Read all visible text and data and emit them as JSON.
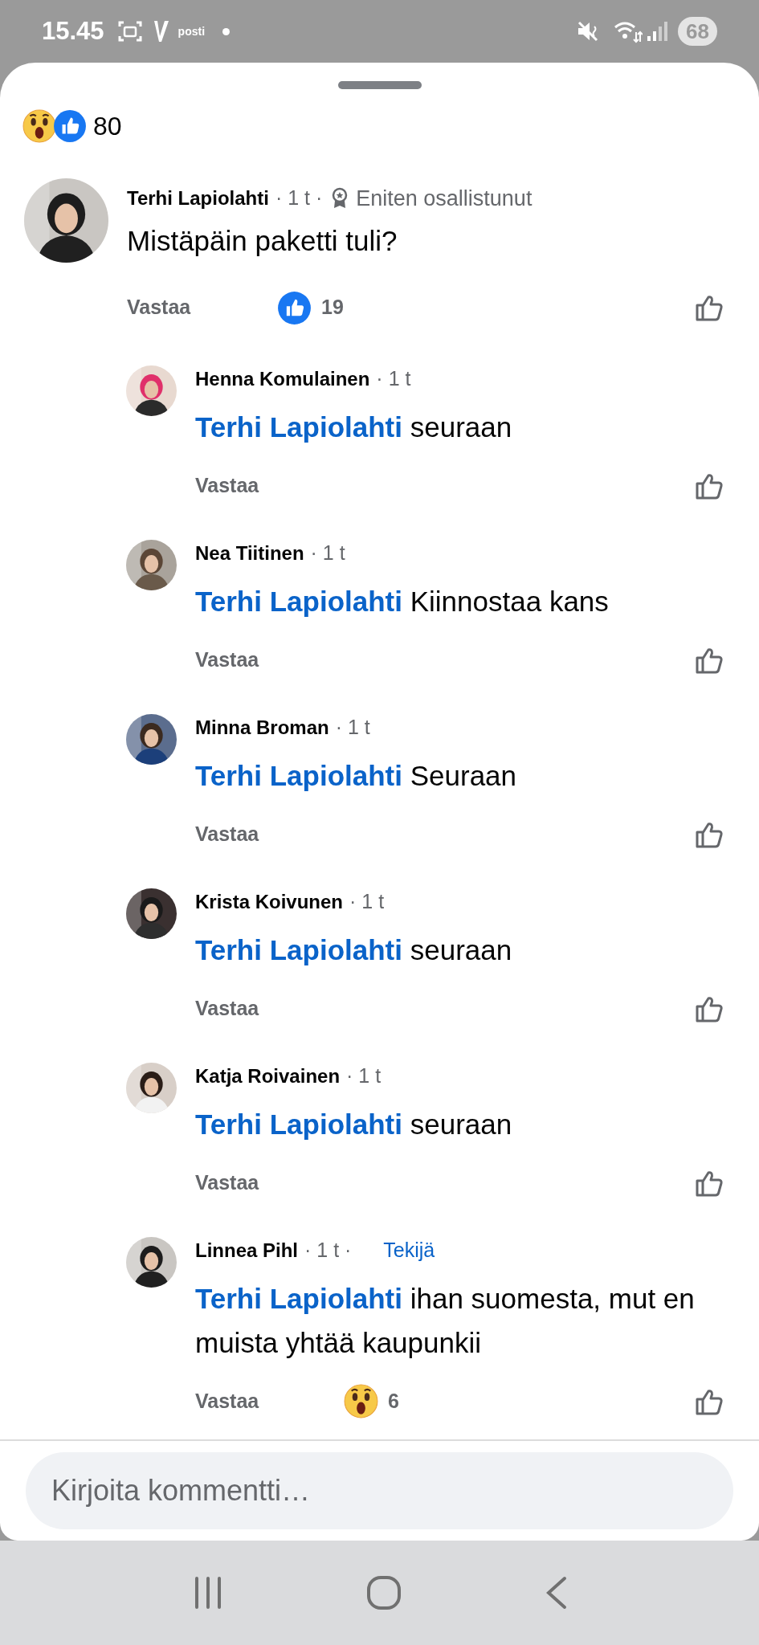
{
  "status_bar": {
    "time": "15.45",
    "app_label": "posti",
    "battery": "68"
  },
  "reactions_summary": {
    "reactions": [
      {
        "kind": "wow"
      },
      {
        "kind": "like"
      }
    ],
    "count": "80"
  },
  "comments": [
    {
      "author": "Terhi Lapiolahti",
      "meta": "· 1 t ·",
      "badge": {
        "kind": "top_fan",
        "label": "Eniten osallistunut"
      },
      "text": "Mistäpäin paketti tuli?",
      "reply_label": "Vastaa",
      "reaction": {
        "kind": "like",
        "count": "19"
      },
      "replies": [
        {
          "author": "Henna Komulainen",
          "meta": "· 1 t",
          "mention": "Terhi Lapiolahti",
          "text": "seuraan",
          "reply_label": "Vastaa"
        },
        {
          "author": "Nea Tiitinen",
          "meta": "· 1 t",
          "mention": "Terhi Lapiolahti",
          "text": "Kiinnostaa kans",
          "reply_label": "Vastaa"
        },
        {
          "author": "Minna Broman",
          "meta": "· 1 t",
          "mention": "Terhi Lapiolahti",
          "text": "Seuraan",
          "reply_label": "Vastaa"
        },
        {
          "author": "Krista Koivunen",
          "meta": "· 1 t",
          "mention": "Terhi Lapiolahti",
          "text": "seuraan",
          "reply_label": "Vastaa"
        },
        {
          "author": "Katja Roivainen",
          "meta": "· 1 t",
          "mention": "Terhi Lapiolahti",
          "text": "seuraan",
          "reply_label": "Vastaa"
        },
        {
          "author": "Linnea Pihl",
          "meta": "· 1 t ·",
          "badge": {
            "kind": "author",
            "label": "Tekijä"
          },
          "mention": "Terhi Lapiolahti",
          "text": "ihan suomesta, mut en muista yhtää kaupunkii",
          "reply_label": "Vastaa",
          "reaction": {
            "kind": "wow",
            "count": "6"
          }
        }
      ]
    }
  ],
  "composer": {
    "placeholder": "Kirjoita kommentti…"
  }
}
